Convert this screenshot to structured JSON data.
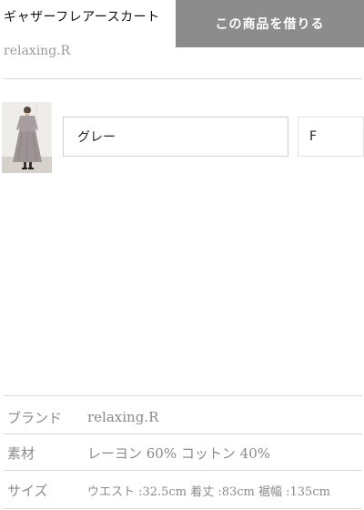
{
  "header": {
    "product_title": "ギャザーフレアースカート",
    "rent_button_label": "この商品を借りる",
    "brand": "relaxing.R"
  },
  "variants": {
    "color_value": "グレー",
    "size_value": "F"
  },
  "specs": [
    {
      "label": "ブランド",
      "value": "relaxing.R"
    },
    {
      "label": "素材",
      "value": "レーヨン 60% コットン 40%"
    },
    {
      "label": "サイズ",
      "value": "ウエスト :32.5cm 着丈 :83cm 裾幅 :135cm"
    }
  ],
  "colors": {
    "button_bg": "#8c8c8c",
    "divider": "#d9d9d9",
    "muted_text": "#8a8a8a"
  }
}
